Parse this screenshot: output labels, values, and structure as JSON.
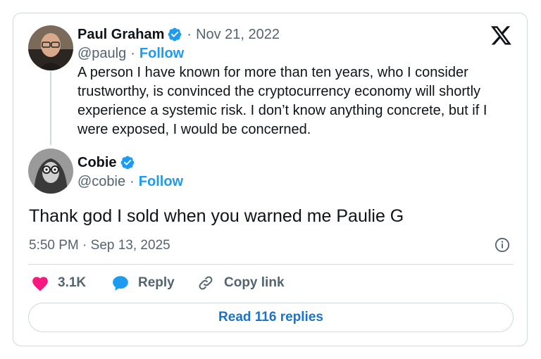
{
  "quoted_tweet": {
    "author_name": "Paul Graham",
    "date": "Nov 21, 2022",
    "handle": "@paulg",
    "follow_label": "Follow",
    "text": "A person I have known for more than ten years, who I consider trustworthy, is convinced the cryptocurrency economy will shortly experience a systemic risk. I don’t know anything concrete, but if I were exposed, I would be concerned."
  },
  "reply_tweet": {
    "author_name": "Cobie",
    "handle": "@cobie",
    "follow_label": "Follow",
    "text": "Thank god I sold when you warned me Paulie G",
    "time": "5:50 PM",
    "date": "Sep 13, 2025"
  },
  "separator": "·",
  "actions": {
    "likes": "3.1K",
    "reply_label": "Reply",
    "copy_link_label": "Copy link"
  },
  "read_replies_label": "Read 116 replies",
  "icons": {
    "brand": "x-logo-icon",
    "verified": "verified-badge-icon",
    "like": "heart-icon",
    "reply": "speech-bubble-icon",
    "copy": "link-icon",
    "info": "info-icon"
  },
  "colors": {
    "accent": "#1d9bf0",
    "like": "#f91880",
    "text": "#0f1419",
    "muted": "#536471",
    "border": "#cfd9de"
  }
}
